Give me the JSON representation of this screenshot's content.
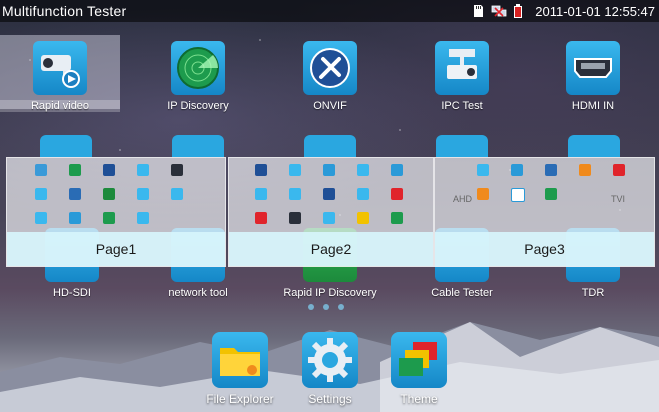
{
  "status": {
    "title": "Multifunction Tester",
    "time": "2011-01-01 12:55:47"
  },
  "apps_row1": [
    {
      "label": "Rapid video",
      "icon": "camera-video-icon"
    },
    {
      "label": "IP Discovery",
      "icon": "radar-icon"
    },
    {
      "label": "ONVIF",
      "icon": "tools-icon"
    },
    {
      "label": "IPC Test",
      "icon": "ptz-camera-icon"
    },
    {
      "label": "HDMI IN",
      "icon": "hdmi-icon"
    }
  ],
  "apps_row3": [
    {
      "label": "HD-SDI",
      "icon": "hd-sdi-icon"
    },
    {
      "label": "network tool",
      "icon": "network-tool-icon"
    },
    {
      "label": "Rapid IP Discovery",
      "icon": "rapid-ip-discovery-icon"
    },
    {
      "label": "Cable Tester",
      "icon": "cable-tester-icon"
    },
    {
      "label": "TDR",
      "icon": "tdr-icon"
    }
  ],
  "page_cards": [
    {
      "label": "Page1"
    },
    {
      "label": "Page2"
    },
    {
      "label": "Page3"
    }
  ],
  "partial_labels": {
    "ahd": "AHD",
    "tvi": "TVI"
  },
  "dock": [
    {
      "label": "File Explorer",
      "icon": "folder-icon"
    },
    {
      "label": "Settings",
      "icon": "gear-icon"
    },
    {
      "label": "Theme",
      "icon": "theme-icon"
    }
  ],
  "colors": {
    "accent": "#2aa7e0",
    "selected": "#d8d8e8",
    "page_label_bg": "#d7f5fc"
  }
}
